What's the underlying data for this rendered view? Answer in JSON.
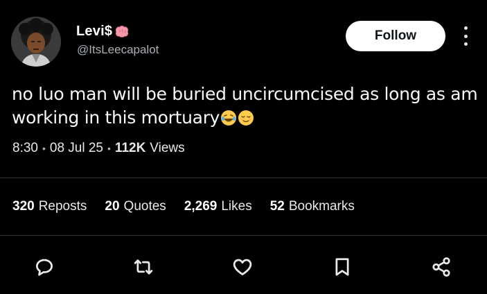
{
  "author": {
    "display_name": "Levi$",
    "handle": "@ItsLeecapalot",
    "name_emoji": "brain-emoji",
    "avatar": "avatar-cartoon-boy"
  },
  "follow_label": "Follow",
  "more_icon": "more-vertical-icon",
  "tweet": {
    "text": "no luo man will be buried uncircumcised as long as am working in this mortuary",
    "emojis": [
      "laughing-emoji",
      "relieved-emoji"
    ]
  },
  "meta": {
    "time": "8:30",
    "date": "08 Jul 25",
    "views_count": "112K",
    "views_label": "Views"
  },
  "stats": [
    {
      "num": "320",
      "label": "Reposts"
    },
    {
      "num": "20",
      "label": "Quotes"
    },
    {
      "num": "2,269",
      "label": "Likes"
    },
    {
      "num": "52",
      "label": "Bookmarks"
    }
  ],
  "actions": [
    "reply-icon",
    "repost-icon",
    "like-icon",
    "bookmark-icon",
    "share-icon"
  ],
  "colors": {
    "background": "#000000",
    "text": "#e7e9ea",
    "secondary": "#aab0b6",
    "divider": "#2f3336"
  }
}
